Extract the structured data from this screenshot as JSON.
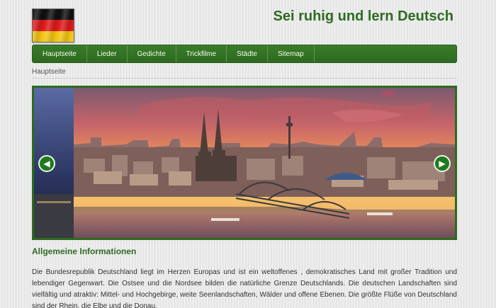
{
  "header": {
    "title": "Sei ruhig und lern Deutsch",
    "logo_icon": "german-flag-icon",
    "flag_colors": [
      "#111111",
      "#dd1b1b",
      "#f2c413"
    ]
  },
  "nav": {
    "items": [
      {
        "label": "Hauptseite"
      },
      {
        "label": "Lieder"
      },
      {
        "label": "Gedichte"
      },
      {
        "label": "Trickfilme"
      },
      {
        "label": "Städte"
      },
      {
        "label": "Sitemap"
      }
    ]
  },
  "breadcrumb": "Hauptseite",
  "slider": {
    "prev_icon": "chevron-left-icon",
    "next_icon": "chevron-right-icon",
    "image": "cologne-cathedral-sunset-photo"
  },
  "main": {
    "section_title": "Allgemeine Informationen",
    "paragraph": "Die Bundesrepublik Deutschland liegt im Herzen Europas und ist ein weltoffenes , demokratisches Land mit großer Tradition und lebendiger Gegenwart. Die Ostsee und die Nordsee bilden die natürliche Grenze Deutschlands. Die deutschen Landschaften sind vielfältig und atraktiv: Mittel- und Hochgebirge, weite Seenlandschaften, Wälder und offene Ebenen. Die größte Flüße von Deutschland sind der Rhein, die Elbe und die Donau."
  },
  "colors": {
    "accent": "#2e6b22",
    "nav_bg": "#347324",
    "arrow": "#1f7a1f"
  }
}
